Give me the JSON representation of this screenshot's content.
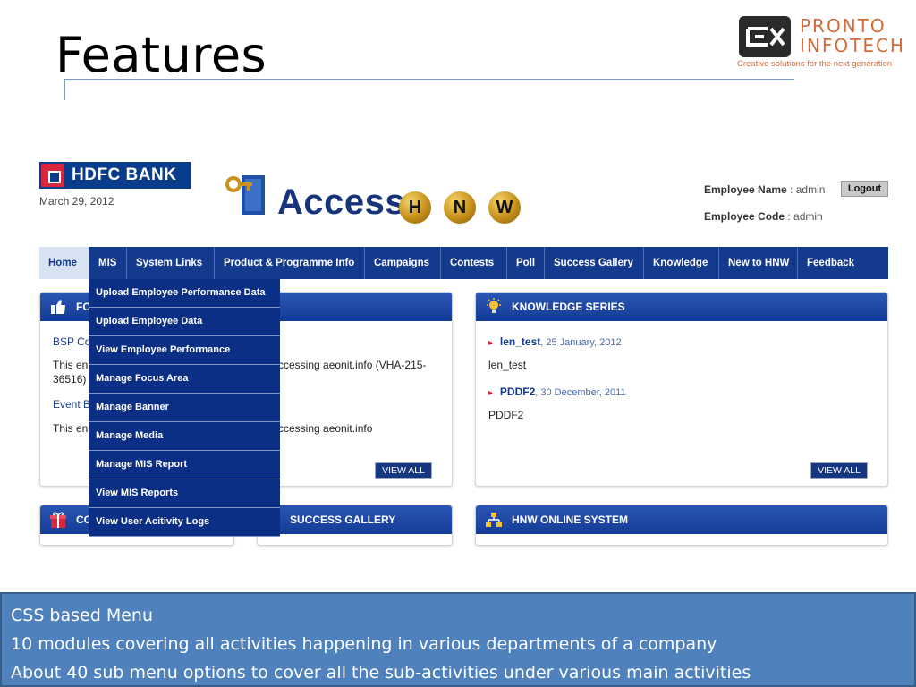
{
  "slide": {
    "title": "Features",
    "logo_name_line1": "PRONTO",
    "logo_name_line2": "INFOTECH",
    "logo_tagline": "Creative solutions for the next generation",
    "accent_color": "#4f81bd"
  },
  "portal": {
    "bank_name": "HDFC BANK",
    "date": "March 29, 2012",
    "app_title": "Access",
    "app_balls": [
      "H",
      "N",
      "W"
    ],
    "employee_name_label": "Employee Name",
    "employee_name_value": ": admin",
    "employee_code_label": "Employee Code",
    "employee_code_value": ": admin",
    "logout_label": "Logout",
    "nav": [
      {
        "label": "Home",
        "active": true
      },
      {
        "label": "MIS",
        "active": false
      },
      {
        "label": "System Links",
        "active": false
      },
      {
        "label": "Product & Programme Info",
        "active": false
      },
      {
        "label": "Campaigns",
        "active": false
      },
      {
        "label": "Contests",
        "active": false
      },
      {
        "label": "Poll",
        "active": false
      },
      {
        "label": "Success Gallery",
        "active": false
      },
      {
        "label": "Knowledge",
        "active": false
      },
      {
        "label": "New to HNW",
        "active": false
      },
      {
        "label": "Feedback",
        "active": false
      }
    ],
    "mis_dropdown": [
      "Upload Employee Performance Data",
      "Upload Employee Data",
      "View Employee Performance",
      "Manage Focus Area",
      "Manage Banner",
      "Manage Media",
      "Manage MIS Report",
      "View MIS Reports",
      "View User Acitivity Logs"
    ],
    "focus_panel": {
      "title": "FO",
      "item1_title": "BSP Co",
      "item1_text_left": "This en",
      "item1_text_right": "ccessing aeonit.info (VHA-215-",
      "item1_text_line2": "36516)",
      "item2_title": "Event B",
      "item2_text_left": "This en",
      "item2_text_right": "ccessing aeonit.info",
      "view_all": "VIEW ALL"
    },
    "knowledge_panel": {
      "title": "KNOWLEDGE SERIES",
      "items": [
        {
          "title": "len_test",
          "date": ", 25 January, 2012",
          "desc": "len_test"
        },
        {
          "title": "PDDF2",
          "date": ", 30 December, 2011",
          "desc": "PDDF2"
        }
      ],
      "view_all": "VIEW ALL"
    },
    "bottom_panels": {
      "left_title": "CO",
      "middle_title": "SUCCESS GALLERY",
      "right_title": "HNW ONLINE SYSTEM"
    }
  },
  "caption": {
    "lines": [
      "CSS based Menu",
      "10 modules covering all activities happening in various departments of a company",
      "About 40 sub menu options to cover all the sub-activities under various main activities"
    ]
  }
}
